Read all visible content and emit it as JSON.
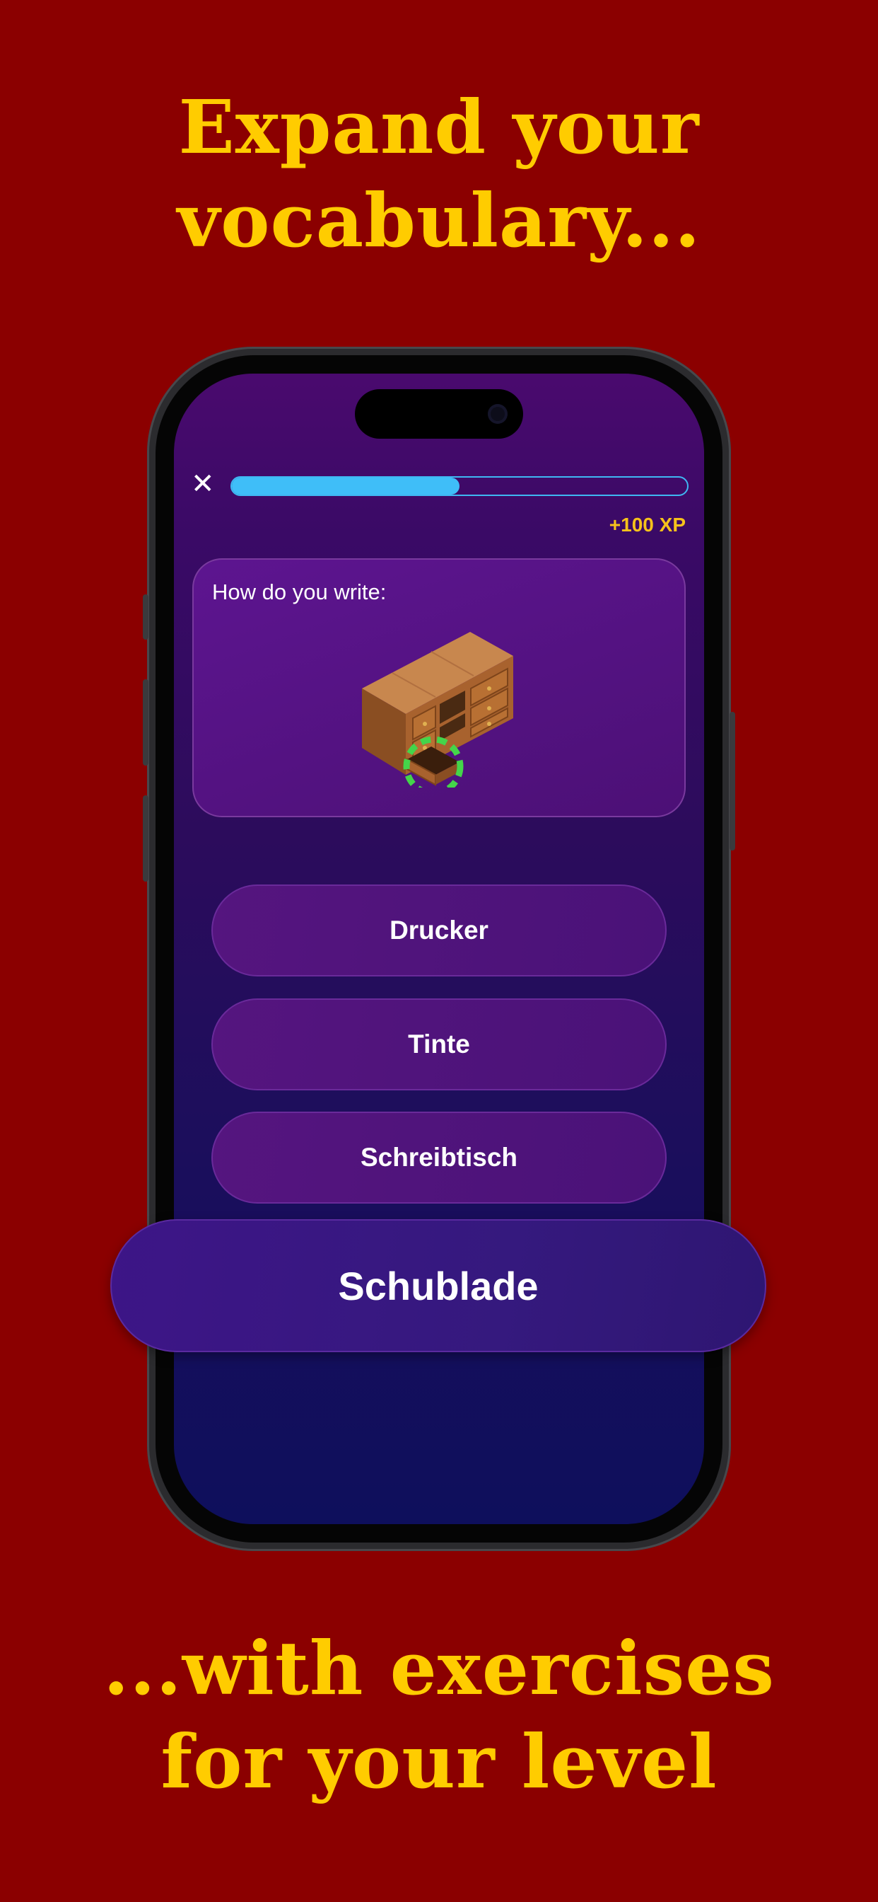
{
  "headline_top": [
    "Expand your",
    "vocabulary..."
  ],
  "headline_bottom": [
    "...with exercises",
    "for your level"
  ],
  "quiz": {
    "close_label": "✕",
    "progress": 0.5,
    "xp_label": "+100 XP",
    "prompt": "How do you write:",
    "illustration_icon": "drawer-cabinet-illustration",
    "options": [
      "Drucker",
      "Tinte",
      "Schreibtisch"
    ],
    "highlighted_option": "Schublade"
  },
  "colors": {
    "background": "#8b0000",
    "headline": "#ffcc00",
    "xp": "#f6c21b",
    "progress": "#3fbef8",
    "highlight_ring": "#44d54a"
  }
}
